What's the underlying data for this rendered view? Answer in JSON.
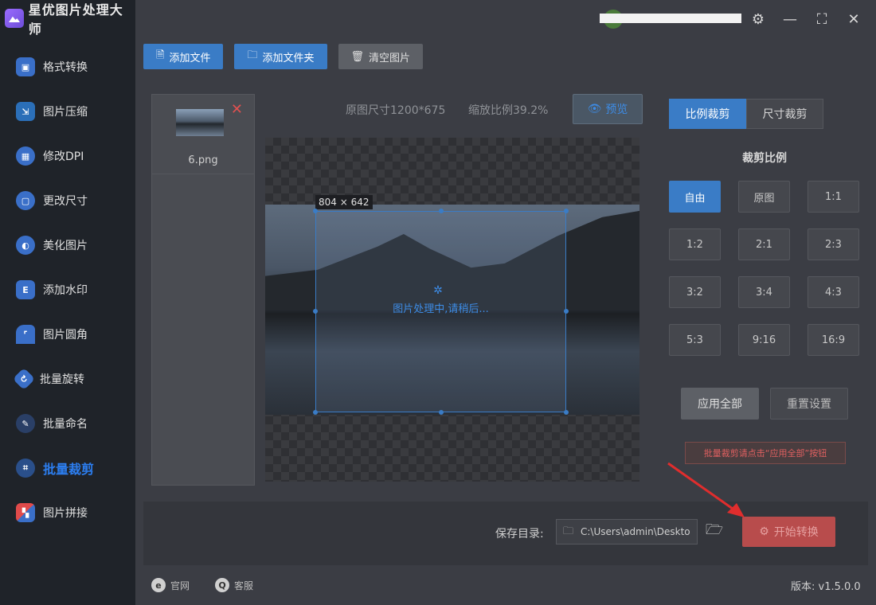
{
  "app": {
    "title": "星优图片处理大师"
  },
  "sidebar": {
    "items": [
      {
        "label": "格式转换",
        "icon": "format-convert-icon",
        "color": "#3a6fc8"
      },
      {
        "label": "图片压缩",
        "icon": "compress-icon",
        "color": "#2b6fb8"
      },
      {
        "label": "修改DPI",
        "icon": "dpi-icon",
        "color": "#3a6fc8"
      },
      {
        "label": "更改尺寸",
        "icon": "resize-icon",
        "color": "#3a6fc8"
      },
      {
        "label": "美化图片",
        "icon": "beautify-icon",
        "color": "#3a6fc8"
      },
      {
        "label": "添加水印",
        "icon": "watermark-icon",
        "color": "#3a6fc8"
      },
      {
        "label": "图片圆角",
        "icon": "rounded-corner-icon",
        "color": "#3a6fc8"
      },
      {
        "label": "批量旋转",
        "icon": "rotate-icon",
        "color": "#3a6fc8"
      },
      {
        "label": "批量命名",
        "icon": "rename-icon",
        "color": "#3a6fc8"
      },
      {
        "label": "批量裁剪",
        "icon": "crop-icon",
        "color": "#2c7ef0",
        "active": true
      },
      {
        "label": "图片拼接",
        "icon": "stitch-icon",
        "color": "#e04a4a"
      }
    ]
  },
  "toolbar": {
    "add_file": "添加文件",
    "add_folder": "添加文件夹",
    "clear_images": "清空图片"
  },
  "file_list": [
    {
      "name": "6.png"
    }
  ],
  "editor": {
    "original_size": "原图尺寸1200*675",
    "scale": "缩放比例39.2%",
    "preview_label": "预览",
    "crop_size_label": "804 × 642",
    "processing_text": "图片处理中,请稍后..."
  },
  "crop_panel": {
    "tabs": [
      {
        "label": "比例裁剪",
        "active": true
      },
      {
        "label": "尺寸裁剪",
        "active": false
      }
    ],
    "section_title": "裁剪比例",
    "ratios": [
      "自由",
      "原图",
      "1:1",
      "1:2",
      "2:1",
      "2:3",
      "3:2",
      "3:4",
      "4:3",
      "5:3",
      "9:16",
      "16:9"
    ],
    "active_ratio": "自由",
    "apply_all": "应用全部",
    "reset": "重置设置",
    "hint": "批量裁剪请点击“应用全部”按钮"
  },
  "bottom": {
    "save_label": "保存目录:",
    "save_path": "C:\\Users\\admin\\Deskto",
    "start_button": "开始转换"
  },
  "footer": {
    "website": "官网",
    "support": "客服",
    "version": "版本: v1.5.0.0"
  },
  "colors": {
    "accent": "#3a7cc6",
    "danger": "#b84c4c",
    "arrow": "#e02d2d"
  }
}
